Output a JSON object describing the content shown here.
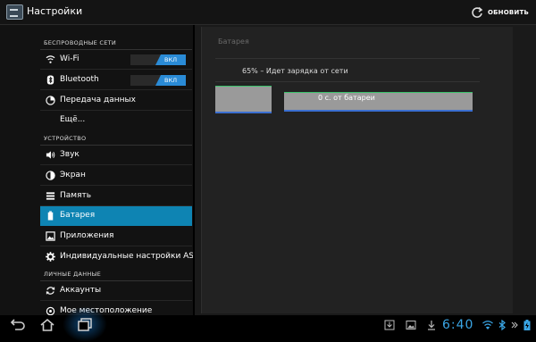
{
  "topbar": {
    "title": "Настройки",
    "refresh_label": "ОБНОВИТЬ"
  },
  "sidebar": {
    "sections": [
      {
        "header": "БЕСПРОВОДНЫЕ СЕТИ"
      },
      {
        "header": "УСТРОЙСТВО"
      },
      {
        "header": "ЛИЧНЫЕ ДАННЫЕ"
      }
    ],
    "items": [
      {
        "label": "Wi-Fi",
        "icon": "wifi-icon",
        "toggle": "ВКЛ"
      },
      {
        "label": "Bluetooth",
        "icon": "bluetooth-icon",
        "toggle": "ВКЛ"
      },
      {
        "label": "Передача данных",
        "icon": "data-usage-icon"
      },
      {
        "label": "Ещё..."
      },
      {
        "label": "Звук",
        "icon": "sound-icon"
      },
      {
        "label": "Экран",
        "icon": "display-icon"
      },
      {
        "label": "Память",
        "icon": "storage-icon"
      },
      {
        "label": "Батарея",
        "icon": "battery-icon",
        "selected": true
      },
      {
        "label": "Приложения",
        "icon": "apps-icon"
      },
      {
        "label": "Индивидуальные настройки ASUS",
        "icon": "gear-icon"
      },
      {
        "label": "Аккаунты",
        "icon": "sync-icon"
      },
      {
        "label": "Мое местоположение",
        "icon": "location-icon"
      }
    ]
  },
  "battery": {
    "title": "Батарея",
    "charging_text": "65% – Идет зарядка от сети",
    "time_on_battery": "0 с. от батареи"
  },
  "statusbar": {
    "clock": "6:40"
  },
  "colors": {
    "accent": "#0e84b3",
    "clock": "#3aa6e6",
    "toggle_on": "#2a8bd6"
  }
}
